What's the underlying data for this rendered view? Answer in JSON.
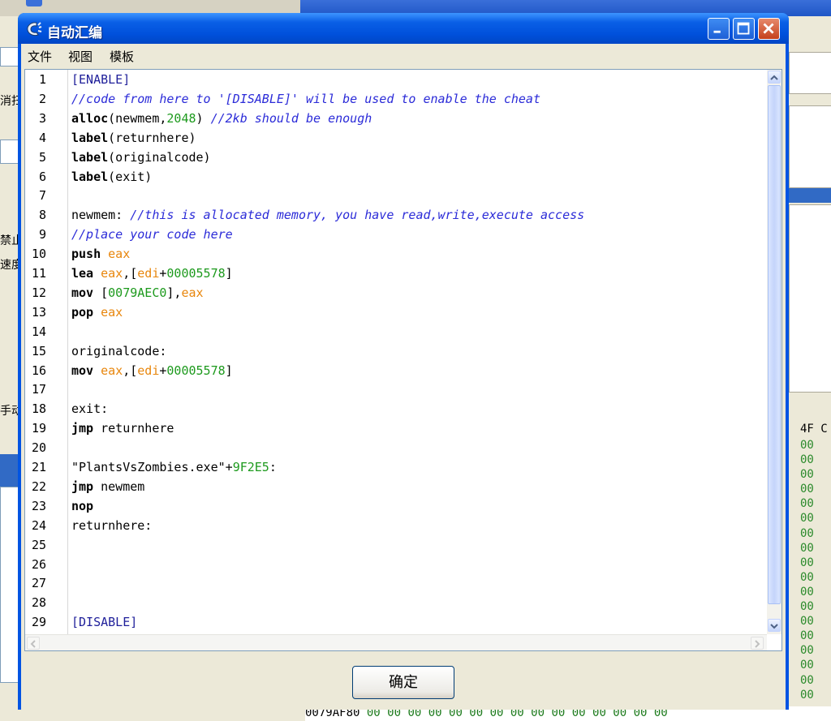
{
  "window": {
    "title": "自动汇编",
    "buttons": {
      "minimize": "minimize-icon",
      "maximize": "maximize-icon",
      "close": "close-icon"
    }
  },
  "menu": [
    "文件",
    "视图",
    "模板"
  ],
  "editor": {
    "lines": [
      [
        {
          "t": "[ENABLE]",
          "c": "br"
        }
      ],
      [
        {
          "t": "//code from here to '[DISABLE]' will be used to enable the cheat",
          "c": "cm"
        }
      ],
      [
        {
          "t": "alloc",
          "c": "kw"
        },
        {
          "t": "(newmem,",
          "c": ""
        },
        {
          "t": "2048",
          "c": "num"
        },
        {
          "t": ") ",
          "c": ""
        },
        {
          "t": "//2kb should be enough",
          "c": "cm"
        }
      ],
      [
        {
          "t": "label",
          "c": "kw"
        },
        {
          "t": "(returnhere)",
          "c": ""
        }
      ],
      [
        {
          "t": "label",
          "c": "kw"
        },
        {
          "t": "(originalcode)",
          "c": ""
        }
      ],
      [
        {
          "t": "label",
          "c": "kw"
        },
        {
          "t": "(exit)",
          "c": ""
        }
      ],
      [],
      [
        {
          "t": "newmem: ",
          "c": ""
        },
        {
          "t": "//this is allocated memory, you have read,write,execute access",
          "c": "cm"
        }
      ],
      [
        {
          "t": "//place your code here",
          "c": "cm"
        }
      ],
      [
        {
          "t": "push ",
          "c": "kw"
        },
        {
          "t": "eax",
          "c": "reg"
        }
      ],
      [
        {
          "t": "lea ",
          "c": "kw"
        },
        {
          "t": "eax",
          "c": "reg"
        },
        {
          "t": ",[",
          "c": ""
        },
        {
          "t": "edi",
          "c": "reg"
        },
        {
          "t": "+",
          "c": ""
        },
        {
          "t": "00005578",
          "c": "num"
        },
        {
          "t": "]",
          "c": ""
        }
      ],
      [
        {
          "t": "mov ",
          "c": "kw"
        },
        {
          "t": "[",
          "c": ""
        },
        {
          "t": "0079AEC0",
          "c": "num"
        },
        {
          "t": "],",
          "c": ""
        },
        {
          "t": "eax",
          "c": "reg"
        }
      ],
      [
        {
          "t": "pop ",
          "c": "kw"
        },
        {
          "t": "eax",
          "c": "reg"
        }
      ],
      [],
      [
        {
          "t": "originalcode:",
          "c": ""
        }
      ],
      [
        {
          "t": "mov ",
          "c": "kw"
        },
        {
          "t": "eax",
          "c": "reg"
        },
        {
          "t": ",[",
          "c": ""
        },
        {
          "t": "edi",
          "c": "reg"
        },
        {
          "t": "+",
          "c": ""
        },
        {
          "t": "00005578",
          "c": "num"
        },
        {
          "t": "]",
          "c": ""
        }
      ],
      [],
      [
        {
          "t": "exit:",
          "c": ""
        }
      ],
      [
        {
          "t": "jmp ",
          "c": "kw"
        },
        {
          "t": "returnhere",
          "c": ""
        }
      ],
      [],
      [
        {
          "t": "\"PlantsVsZombies.exe\"+",
          "c": ""
        },
        {
          "t": "9F2E5",
          "c": "num"
        },
        {
          "t": ":",
          "c": ""
        }
      ],
      [
        {
          "t": "jmp ",
          "c": "kw"
        },
        {
          "t": "newmem",
          "c": ""
        }
      ],
      [
        {
          "t": "nop",
          "c": "kw"
        }
      ],
      [
        {
          "t": "returnhere:",
          "c": ""
        }
      ],
      [],
      [],
      [],
      [],
      [
        {
          "t": "[DISABLE]",
          "c": "br"
        }
      ]
    ]
  },
  "ok_button": "确定",
  "background": {
    "left_labels": [
      "消扫",
      "禁止",
      "速度",
      "手动"
    ],
    "hex_header": "4F C",
    "hex_cell": "00",
    "hex_bottom_addr": "0079AF80",
    "hex_bottom_cells": "00 00 00 00 00 00 00 00 00 00 00 00 00 00 00"
  }
}
